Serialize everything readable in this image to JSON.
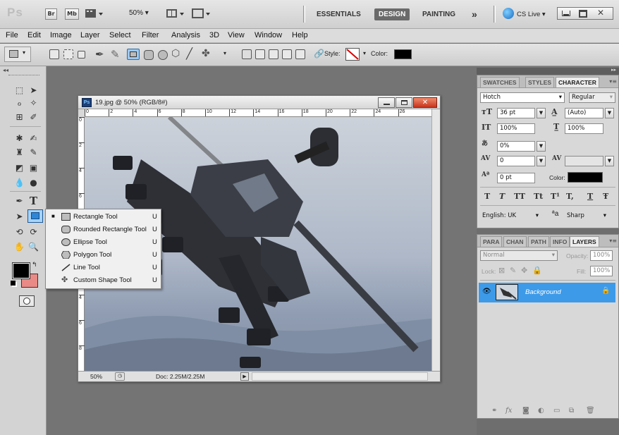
{
  "app": {
    "logo": "Ps",
    "bridge_label": "Br",
    "minibridge_label": "Mb",
    "zoom": "50%"
  },
  "workspaces": {
    "essentials": "ESSENTIALS",
    "design": "DESIGN",
    "painting": "PAINTING",
    "more": "»",
    "cslive": "CS Live"
  },
  "menu": {
    "file": "File",
    "edit": "Edit",
    "image": "Image",
    "layer": "Layer",
    "select": "Select",
    "filter": "Filter",
    "analysis": "Analysis",
    "3d": "3D",
    "view": "View",
    "window": "Window",
    "help": "Help"
  },
  "options": {
    "style_label": "Style:",
    "color_label": "Color:",
    "color_value": "#000000"
  },
  "document": {
    "title": "19.jpg @ 50% (RGB/8#)",
    "ruler_h": [
      "0",
      "2",
      "4",
      "6",
      "8",
      "10",
      "12",
      "14",
      "16",
      "18",
      "20",
      "22",
      "24",
      "26"
    ],
    "ruler_v": [
      "0",
      "2",
      "4",
      "6",
      "8",
      "0",
      "2",
      "4",
      "6",
      "8"
    ],
    "zoom": "50%",
    "doc_size": "Doc: 2.25M/2.25M"
  },
  "flyout": [
    {
      "label": "Rectangle Tool",
      "key": "U",
      "icon": "rectangle-icon",
      "selected": true
    },
    {
      "label": "Rounded Rectangle Tool",
      "key": "U",
      "icon": "rounded-rectangle-icon",
      "selected": false
    },
    {
      "label": "Ellipse Tool",
      "key": "U",
      "icon": "ellipse-icon",
      "selected": false
    },
    {
      "label": "Polygon Tool",
      "key": "U",
      "icon": "polygon-icon",
      "selected": false
    },
    {
      "label": "Line Tool",
      "key": "U",
      "icon": "line-icon",
      "selected": false
    },
    {
      "label": "Custom Shape Tool",
      "key": "U",
      "icon": "custom-shape-icon",
      "selected": false
    }
  ],
  "colors": {
    "foreground": "#000000",
    "background": "#e98a86",
    "accent": "#3d9ae8"
  },
  "character": {
    "tabs": [
      "SWATCHES",
      "STYLES",
      "CHARACTER"
    ],
    "font_family": "Hotch",
    "font_style": "Regular",
    "font_size": "36 pt",
    "leading": "(Auto)",
    "vertical_scale": "100%",
    "horizontal_scale": "100%",
    "tsume": "0%",
    "kerning": "0",
    "tracking": "",
    "baseline": "0 pt",
    "color_label": "Color:",
    "color_value": "#000000",
    "style_buttons": [
      "T",
      "T",
      "TT",
      "Tt",
      "T¹",
      "T,",
      "T",
      "Ŧ"
    ],
    "language": "English: UK",
    "aa_symbol": "ªa",
    "antialias": "Sharp"
  },
  "layers": {
    "tabs": [
      "PARA",
      "CHAN",
      "PATH",
      "INFO",
      "LAYERS"
    ],
    "blend": "Normal",
    "opacity_label": "Opacity:",
    "opacity": "100%",
    "lock_label": "Lock:",
    "fill_label": "Fill:",
    "fill": "100%",
    "layer_name": "Background"
  }
}
